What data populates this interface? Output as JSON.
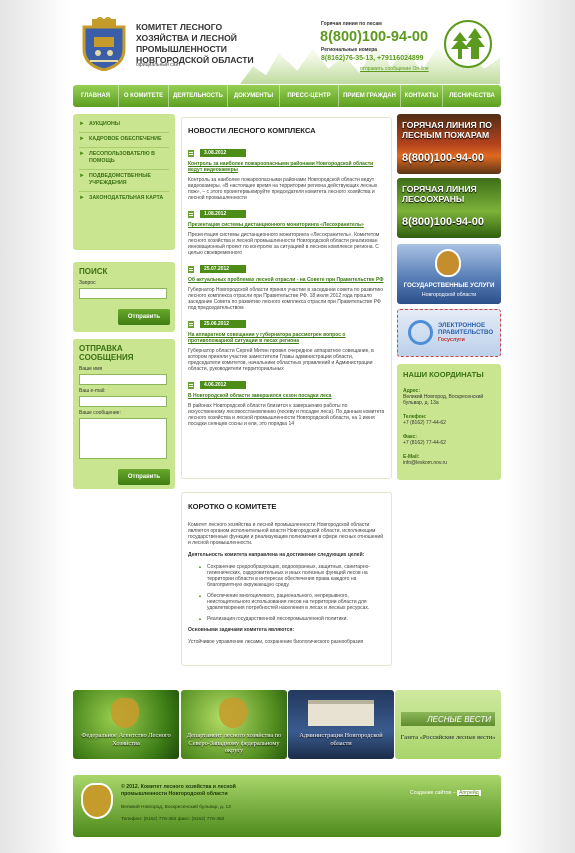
{
  "header": {
    "title": "Комитет лесного хозяйства и лесной промышленности Новгородской области",
    "subtitle": "официальный сайт",
    "hotline_label": "Горячая линия по лесам",
    "hotline_phone": "8(800)100-94-00",
    "regional_label": "Региональные номера",
    "regional_phones": "8(8162)76-35-13, +79116024899",
    "send_message": "отправить сообщение On-line"
  },
  "nav": [
    "Главная",
    "О комитете",
    "Деятельность",
    "Документы",
    "Пресс-центр",
    "Прием граждан",
    "Контакты",
    "Лесничества"
  ],
  "sidebar": {
    "items": [
      "Аукционы",
      "Кадровое обеспечение",
      "Лесопользователю в помощь",
      "Подведомственные учреждения",
      "Законодательная карта"
    ]
  },
  "search": {
    "title": "Поиск",
    "field_label": "Запрос",
    "button": "Отправить"
  },
  "message_form": {
    "title": "Отправка сообщения",
    "name_label": "Ваше имя",
    "email_label": "Ваш e-mail:",
    "message_label": "Ваше сообщение:",
    "button": "Отправить"
  },
  "news": {
    "title": "Новости лесного комплекса",
    "items": [
      {
        "date": "3.08.2012",
        "link": "Контроль за наиболее пожароопасными районами Новгородской области ведут видеокамеры",
        "text": "Контроль за наиболее пожароопасными районами Новгородской области ведут видеокамеры. «В настоящее время на территории региона действующих лесных пож», – с этого проинтервьюируйте председателя комитета лесного хозяйства и лесной промышленности"
      },
      {
        "date": "1.08.2012",
        "link": "Презентация системы дистанционного мониторинга «Лесохранитель»",
        "text": "Презентация системы дистанционного мониторинга «Лесохранитель». Комитетом лесного хозяйства и лесной промышленности Новгородской области реализован инновационный проект по контролю за ситуацией в лесном комплексе региона. С целью своевременного"
      },
      {
        "date": "25.07.2012",
        "link": "Об актуальных проблемах лесной отрасли - на Совете при Правительстве РФ",
        "text": "Губернатор Новгородской области принял участие в заседании совета по развитию лесного комплекса отрасли при Правительстве РФ. 18 июля 2012 года прошло заседание Совета по развитию лесного комплекса отрасли при Правительстве РФ под председательством"
      },
      {
        "date": "25.06.2012",
        "link": "На аппаратном совещании у губернатора рассмотрен вопрос о противопожарной ситуации в лесах региона",
        "text": "Губернатор области Сергей Митин провел очередное аппаратное совещание, в котором приняли участие заместители Главы администрации области, председатели комитетов, начальники областных управлений и Администрации области, руководители территориальных"
      },
      {
        "date": "4.06.2012",
        "link": "В Новгородской области завершился сезон посадки леса",
        "text": "В районах Новгородской области близится к завершению работы по искусственному лесовосстановлению (посеву и посадке леса). По данным комитета лесного хозяйства и лесной промышленности Новгородской области, на 1 июня посадки сеянцев сосны и ели, это порядка 14"
      }
    ]
  },
  "about": {
    "title": "Коротко о комитете",
    "intro": "Комитет лесного хозяйства и лесной промышленности Новгородской области является органом исполнительной власти Новгородской области, исполняющим государственные функции и реализующим полномочия в сфере лесных отношений и лесной промышленности.",
    "directions_title": "Деятельность комитета направлена на достижение следующих целей:",
    "directions": [
      "Сохранение средообразующих, водоохранных, защитных, санитарно-гигиенических, оздоровительных и иных полезных функций лесов на территории области в интересах обеспечения права каждого на благоприятную окружающую среду.",
      "Обеспечение многоцелевого, рационального, непрерывного, неистощительного использования лесов на территории области для удовлетворения потребностей населения в лесах и лесных ресурсах.",
      "Реализация государственной лесопромышленной политики."
    ],
    "tasks_title": "Основными задачами комитета являются:",
    "tasks_text": "Устойчивое управление лесами, сохранение биологического разнообразия"
  },
  "banners": {
    "fire_title": "Горячая линия по лесным пожарам",
    "fire_phone": "8(800)100-94-00",
    "guard_title": "Горячая линия лесоохраны",
    "guard_phone": "8(800)100-94-00",
    "gov_services_title": "Государственные услуги",
    "gov_services_sub": "Новгородской области",
    "egov_title": "Электронное правительство",
    "egov_sub": "Госуслуги"
  },
  "contacts": {
    "title": "Наши координаты",
    "address_label": "Адрес:",
    "address": "Великий Новгород, Воскресенский бульвар, д. 13а",
    "phone_label": "Телефон:",
    "phone": "+7 (8162) 77-44-62",
    "fax_label": "Факс:",
    "fax": "+7 (8162) 77-44-62",
    "email_label": "E-Mail:",
    "email": "info@leskom.nov.ru"
  },
  "bottom_banners": [
    "Федеральное Агентство Лесного Хозяйства",
    "Департамент лесного хозяйства по Северо-Западному федеральному округу",
    "Администрация Новгородской области",
    "Газета «Российские лесные вести»"
  ],
  "lesnye_vesti_logo": "ЛЕСНЫЕ ВЕСТИ",
  "footer": {
    "copyright": "© 2012. Комитет лесного хозяйства и лесной промышленности Новгородской области",
    "address": "Великий Новгород, Воскресенский бульвар, д. 13",
    "phone": "Телефон: (8162) 776-462 факс: (8162) 776-462",
    "made_by_label": "Создание сайтов –",
    "made_by_link": "Апгрейд"
  }
}
